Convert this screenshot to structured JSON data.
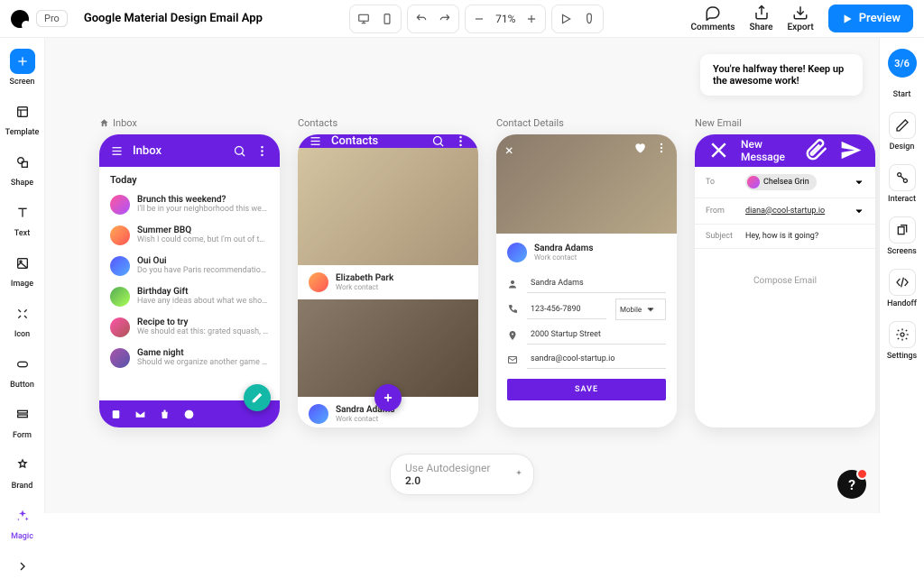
{
  "topbar": {
    "pro_badge": "Pro",
    "project_title": "Google Material Design Email App",
    "zoom": "71%",
    "actions": {
      "comments": "Comments",
      "share": "Share",
      "export": "Export",
      "preview": "Preview"
    }
  },
  "left_rail": [
    "Screen",
    "Template",
    "Shape",
    "Text",
    "Image",
    "Icon",
    "Button",
    "Form",
    "Brand",
    "Magic"
  ],
  "right_rail": {
    "step": "3/6",
    "items": [
      "Start",
      "Design",
      "Interact",
      "Screens",
      "Handoff",
      "Settings"
    ]
  },
  "tip": "You're halfway there! Keep up the awesome work!",
  "screens": [
    {
      "label": "Inbox",
      "title": "Inbox",
      "section": "Today",
      "emails": [
        {
          "subj": "Brunch this weekend?",
          "prev": "I'll be in your neighborhood this weekend…"
        },
        {
          "subj": "Summer BBQ",
          "prev": "Wish I could come, but I'm out of town thi…"
        },
        {
          "subj": "Oui Oui",
          "prev": "Do you have Paris recommendations? Ha…"
        },
        {
          "subj": "Birthday Gift",
          "prev": "Have any ideas about what we should get…"
        },
        {
          "subj": "Recipe to try",
          "prev": "We should eat this: grated squash, corn, a…"
        },
        {
          "subj": "Game night",
          "prev": "Should we organize another game night ti…"
        }
      ]
    },
    {
      "label": "Contacts",
      "title": "Contacts",
      "contacts": [
        {
          "name": "Elizabeth Park",
          "sub": "Work contact"
        },
        {
          "name": "Sandra Adams",
          "sub": "Work contact"
        }
      ]
    },
    {
      "label": "Contact Details",
      "person": {
        "name": "Sandra Adams",
        "sub": "Work contact"
      },
      "fields": {
        "name": "Sandra Adams",
        "phone": "123-456-7890",
        "phone_type": "Mobile",
        "address": "2000 Startup Street",
        "email": "sandra@cool-startup.io",
        "save": "SAVE"
      }
    },
    {
      "label": "New Email",
      "title": "New Message",
      "to_label": "To",
      "to_chip": "Chelsea Grin",
      "from_label": "From",
      "from_val": "diana@cool-startup.io",
      "subject_label": "Subject",
      "subject_val": "Hey, how is it going?",
      "body_placeholder": "Compose Email"
    }
  ],
  "autodesigner": {
    "prefix": "Use Autodesigner ",
    "version": "2.0"
  },
  "help": "?"
}
